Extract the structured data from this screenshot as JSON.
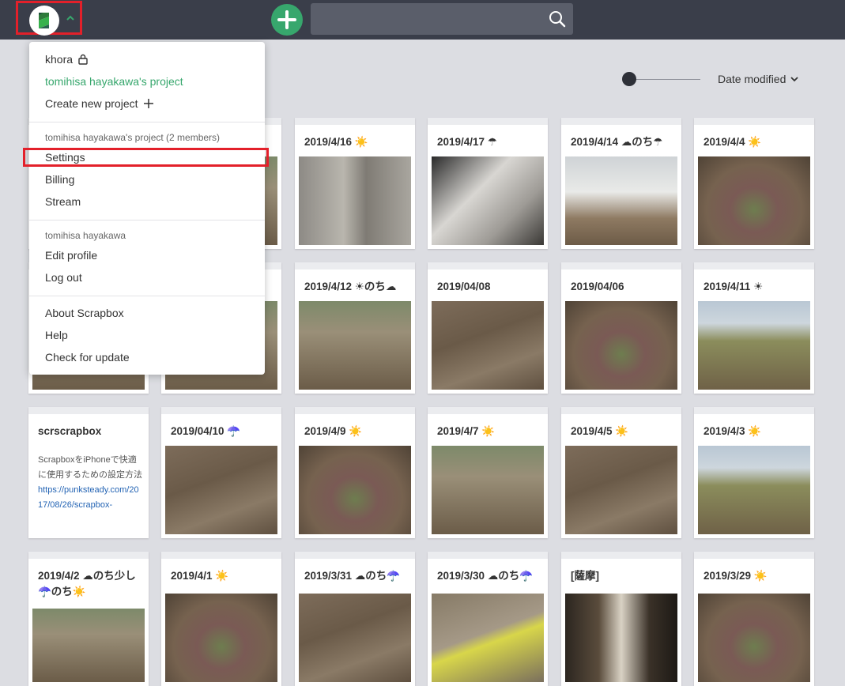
{
  "header": {
    "logo": "scrapbox-logo-icon",
    "search_placeholder": ""
  },
  "sort": {
    "label": "Date modified"
  },
  "menu": {
    "projects": [
      {
        "label": "khora",
        "icon": "lock-icon"
      },
      {
        "label": "tomihisa hayakawa's project",
        "current": true
      },
      {
        "label": "Create new project",
        "icon": "plus-icon"
      }
    ],
    "project_section": {
      "header": "tomihisa hayakawa's project (2 members)",
      "items": [
        "Settings",
        "Billing",
        "Stream"
      ]
    },
    "user_section": {
      "header": "tomihisa hayakawa",
      "items": [
        "Edit profile",
        "Log out"
      ]
    },
    "app_section": {
      "items": [
        "About Scrapbox",
        "Help",
        "Check for update"
      ]
    }
  },
  "cards": [
    {
      "title": "",
      "thumb": "garden"
    },
    {
      "title": "",
      "thumb": "garden"
    },
    {
      "title": "2019/4/16 ☀️",
      "thumb": "wall"
    },
    {
      "title": "2019/4/17 ☂",
      "thumb": "bags"
    },
    {
      "title": "2019/4/14 ☁のち☂",
      "thumb": "house"
    },
    {
      "title": "2019/4/4 ☀️",
      "thumb": "plant"
    },
    {
      "title": "",
      "thumb": "garden"
    },
    {
      "title": "",
      "thumb": "garden"
    },
    {
      "title": "2019/4/12 ☀のち☁",
      "thumb": "garden"
    },
    {
      "title": "2019/04/08",
      "thumb": "soil"
    },
    {
      "title": "2019/04/06",
      "thumb": "plant"
    },
    {
      "title": "2019/4/11 ☀",
      "thumb": "field"
    },
    {
      "title": "scrscrapbox",
      "desc": "ScrapboxをiPhoneで快適に使用するための設定方法",
      "link": "https://punksteady.com/2017/08/26/scrapbox-"
    },
    {
      "title": "2019/04/10 ☂️",
      "thumb": "soil"
    },
    {
      "title": "2019/4/9 ☀️",
      "thumb": "plant"
    },
    {
      "title": "2019/4/7 ☀️",
      "thumb": "garden"
    },
    {
      "title": "2019/4/5 ☀️",
      "thumb": "soil"
    },
    {
      "title": "2019/4/3 ☀️",
      "thumb": "field"
    },
    {
      "title": "2019/4/2 ☁のち少し☂️のち☀️",
      "thumb": "garden"
    },
    {
      "title": "2019/4/1 ☀️",
      "thumb": "plant"
    },
    {
      "title": "2019/3/31 ☁のち☂️",
      "thumb": "soil"
    },
    {
      "title": "2019/3/30 ☁のち☂️",
      "thumb": "dog"
    },
    {
      "title": "[薩摩]",
      "thumb": "shop"
    },
    {
      "title": "2019/3/29 ☀️",
      "thumb": "plant"
    }
  ]
}
